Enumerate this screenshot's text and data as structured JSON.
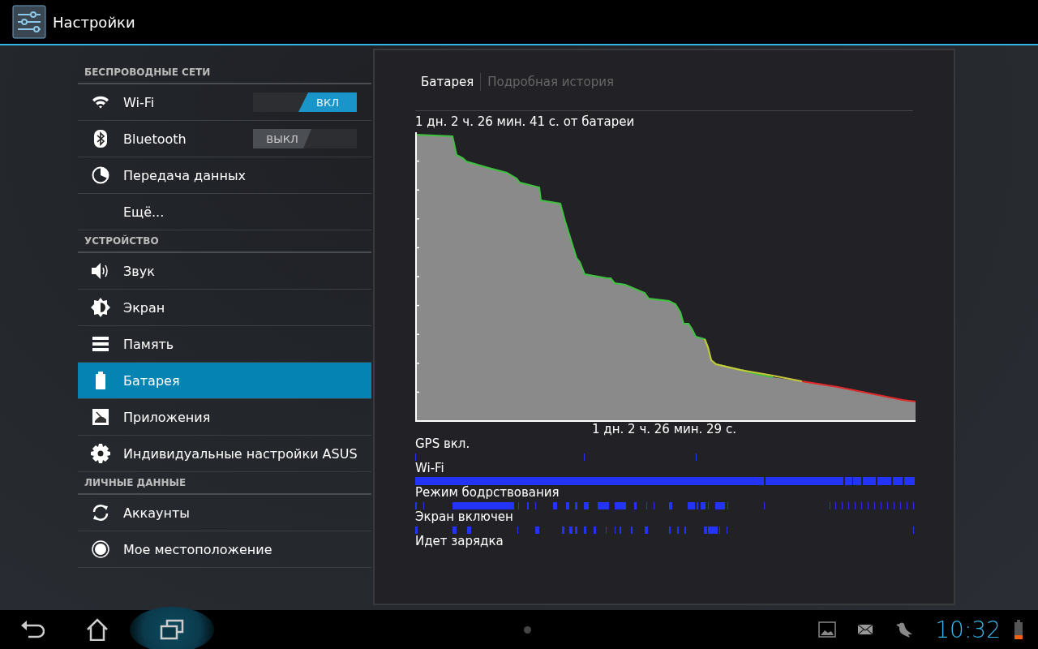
{
  "app_bar": {
    "title": "Настройки"
  },
  "sections": [
    {
      "header": "БЕСПРОВОДНЫЕ СЕТИ",
      "items": [
        {
          "label": "Wi-Fi",
          "selected": false,
          "toggle": {
            "label": "ВКЛ",
            "on": true
          }
        },
        {
          "label": "Bluetooth",
          "selected": false,
          "toggle": {
            "label": "ВЫКЛ",
            "on": false
          }
        },
        {
          "label": "Передача данных",
          "selected": false
        },
        {
          "label": "Ещё...",
          "selected": false
        }
      ]
    },
    {
      "header": "УСТРОЙСТВО",
      "items": [
        {
          "label": "Звук",
          "selected": false
        },
        {
          "label": "Экран",
          "selected": false
        },
        {
          "label": "Память",
          "selected": false
        },
        {
          "label": "Батарея",
          "selected": true
        },
        {
          "label": "Приложения",
          "selected": false
        },
        {
          "label": "Индивидуальные настройки ASUS",
          "selected": false
        }
      ]
    },
    {
      "header": "ЛИЧНЫЕ ДАННЫЕ",
      "items": [
        {
          "label": "Аккаунты",
          "selected": false
        },
        {
          "label": "Мое местоположение",
          "selected": false
        }
      ]
    }
  ],
  "panel": {
    "tabs": [
      {
        "label": "Батарея",
        "selected": true
      },
      {
        "label": "Подробная история",
        "selected": false
      }
    ],
    "on_battery": "1 дн. 2 ч. 26 мин. 41 с. от батареи",
    "graph_time": "1 дн. 2 ч. 26 мин. 29 с.",
    "activities": [
      "GPS вкл.",
      "Wi-Fi",
      "Режим бодрствования",
      "Экран включен",
      "Идет зарядка"
    ]
  },
  "nav_bar": {
    "clock": "10:32"
  }
}
